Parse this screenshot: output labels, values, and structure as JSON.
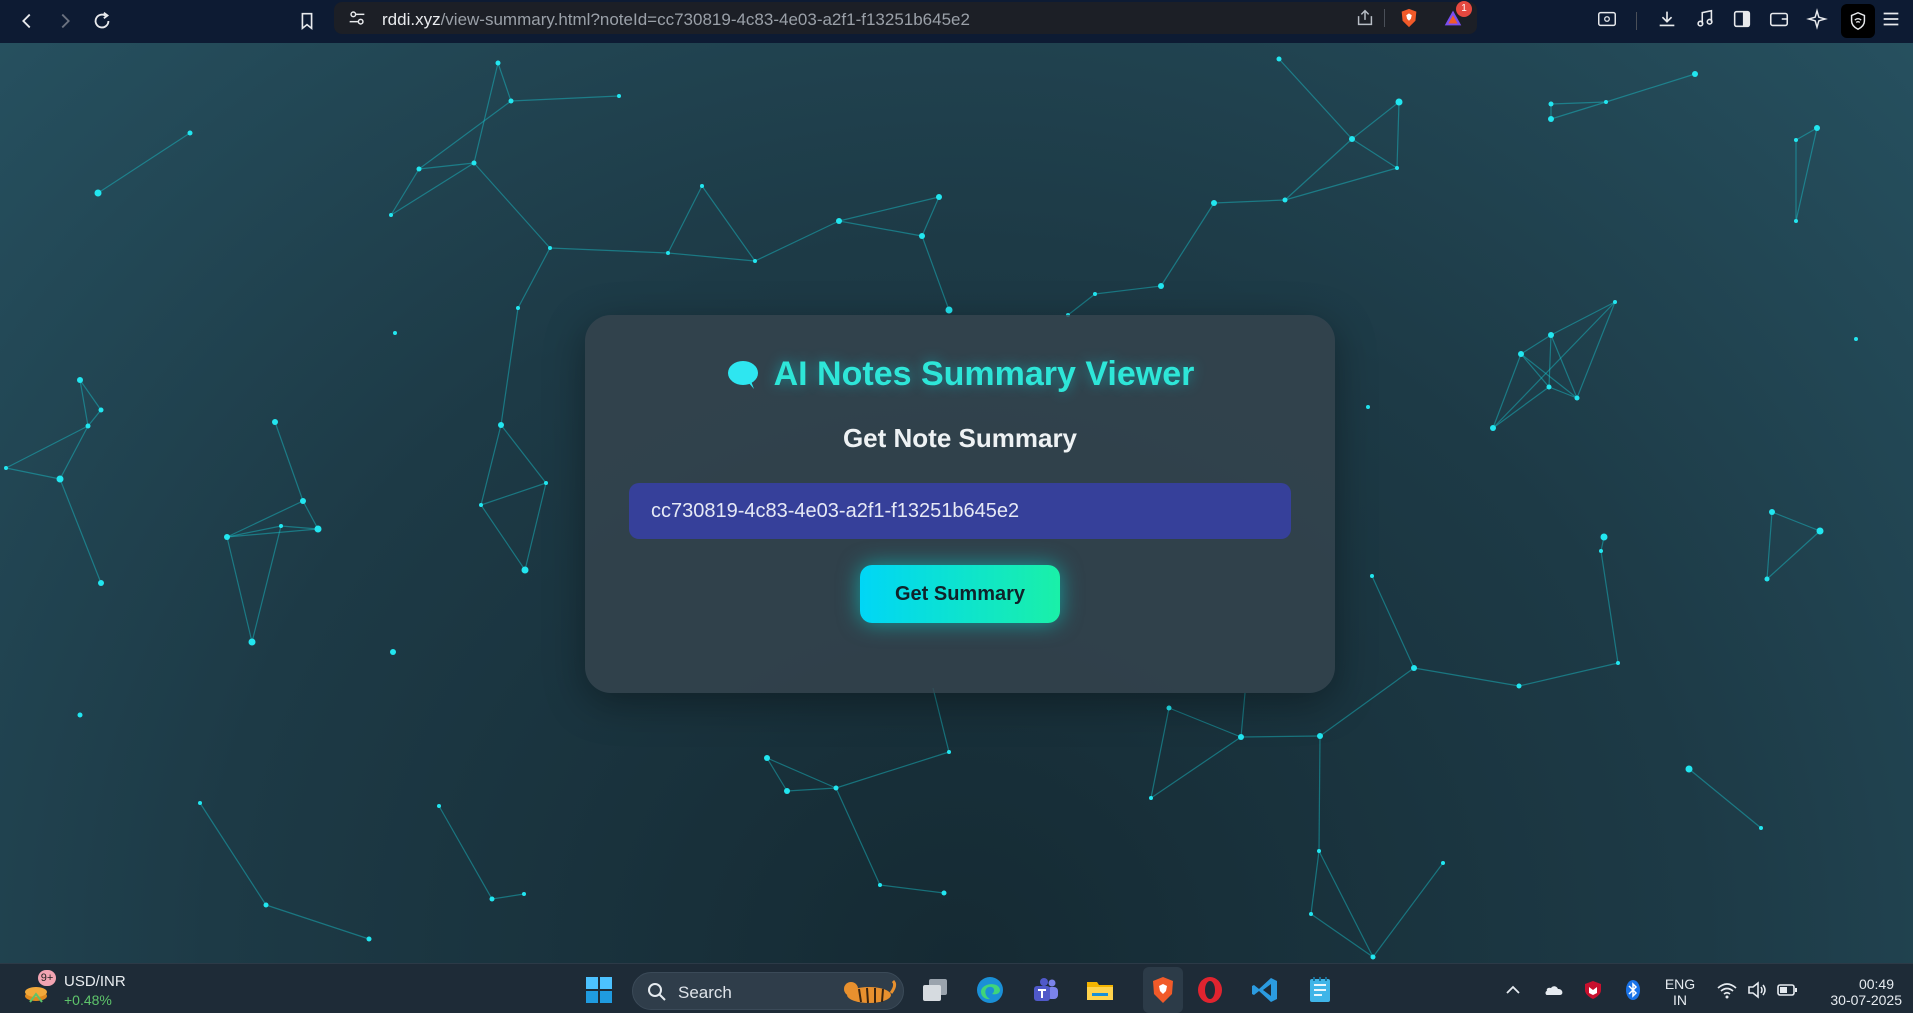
{
  "browser": {
    "url_host": "rddi.xyz",
    "url_path": "/view-summary.html?noteId=cc730819-4c83-4e03-a2f1-f13251b645e2",
    "brave_rewards_badge": "1"
  },
  "card": {
    "title": "AI Notes Summary Viewer",
    "subtitle": "Get Note Summary",
    "note_input_value": "cc730819-4c83-4e03-a2f1-f13251b645e2",
    "button_label": "Get Summary"
  },
  "taskbar": {
    "widget_badge": "9+",
    "widget_title": "USD/INR",
    "widget_change": "+0.48%",
    "search_label": "Search",
    "language_line1": "ENG",
    "language_line2": "IN",
    "time": "00:49",
    "date": "30-07-2025"
  },
  "colors": {
    "accent_gradient_start": "#00d6f6",
    "accent_gradient_end": "#1af0a8",
    "title_color": "#2ee6d8",
    "input_bg": "#36409a",
    "card_bg": "#36444e"
  }
}
